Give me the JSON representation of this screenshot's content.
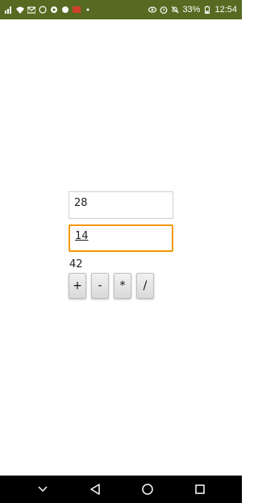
{
  "status_bar": {
    "battery_percent": "33%",
    "time": "12:54",
    "left_icons": [
      "signal-icon",
      "wifi-icon",
      "gmail-icon",
      "whatsapp-icon",
      "chrome-icon",
      "skype-icon",
      "app-icon",
      "more-dot-icon"
    ],
    "right_icons": [
      "eye-icon",
      "alarm-icon",
      "mute-icon",
      "battery-icon"
    ],
    "background": "#566b21"
  },
  "app": {
    "first_value": "28",
    "second_value": "14",
    "result": "42",
    "operators": [
      "+",
      "-",
      "*",
      "/"
    ],
    "focus_color": "#f29900"
  },
  "nav_bar": {
    "buttons": [
      "chevron-down-icon",
      "back-icon",
      "home-icon",
      "recents-icon"
    ]
  }
}
